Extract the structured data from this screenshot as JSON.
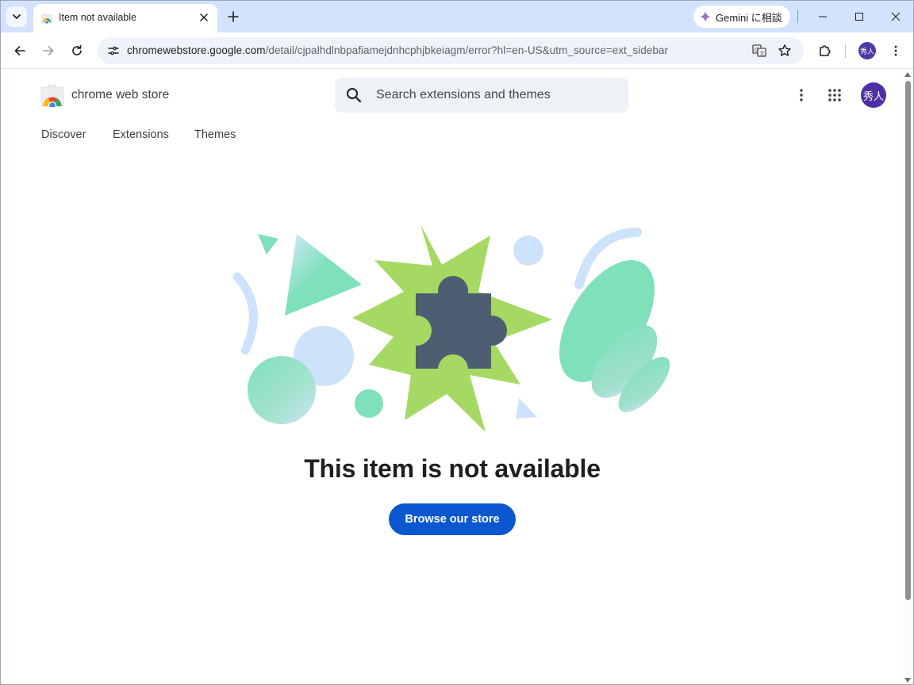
{
  "browser": {
    "tab": {
      "title": "Item not available"
    },
    "gemini_button": {
      "label": "Gemini に相談"
    },
    "address_bar": {
      "host": "chromewebstore.google.com",
      "path": "/detail/cjpalhdlnbpafiamejdnhcphjbkeiagm/error?hl=en-US&utm_source=ext_sidebar"
    },
    "profile_initials": "秀人"
  },
  "store": {
    "name": "chrome web store",
    "search": {
      "placeholder": "Search extensions and themes"
    },
    "nav": [
      {
        "label": "Discover"
      },
      {
        "label": "Extensions"
      },
      {
        "label": "Themes"
      }
    ],
    "avatar_initials": "秀人"
  },
  "error": {
    "title": "This item is not available",
    "button_label": "Browse our store"
  },
  "colors": {
    "accent": "#0b57d0",
    "tabstrip": "#d3e3fd",
    "avatar": "#4e2fa5",
    "starburst": "#a6d963",
    "puzzle": "#4e5e72",
    "mint": "#7fe0bc",
    "light_blue": "#cde2fb"
  }
}
